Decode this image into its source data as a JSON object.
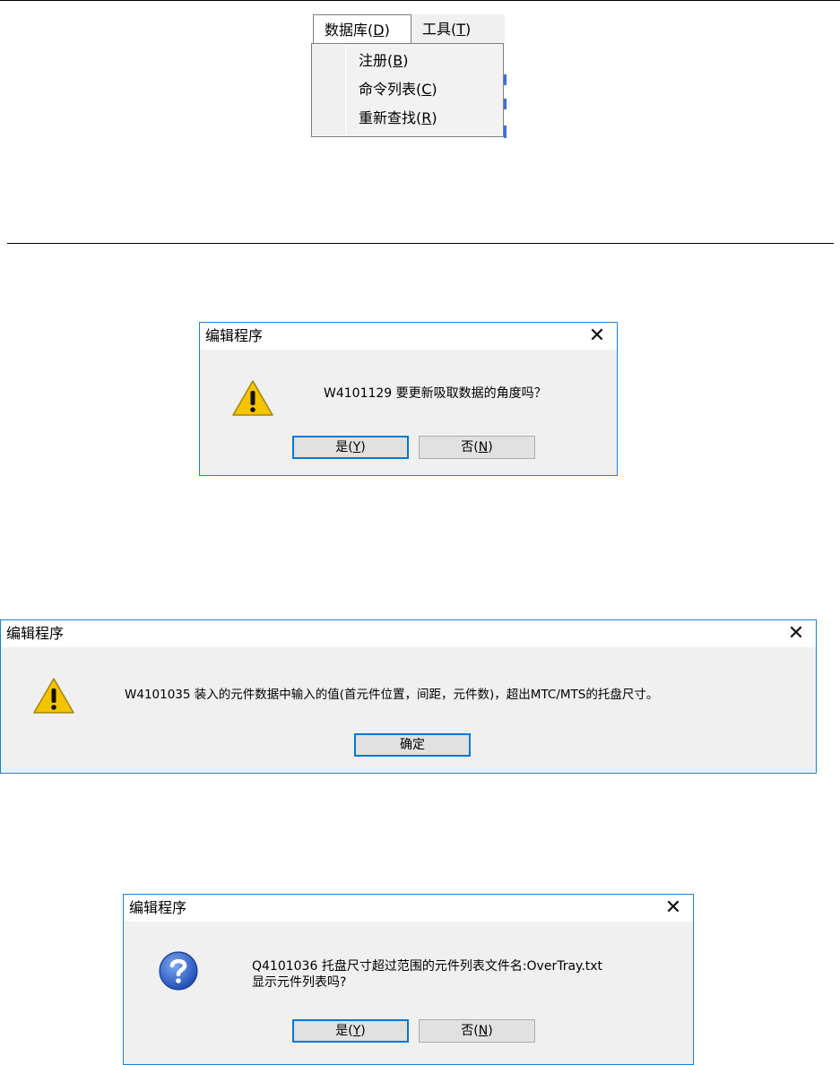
{
  "menu": {
    "tabs": [
      {
        "text": "数据库(",
        "key": "D",
        "close": ")"
      },
      {
        "text": "工具(",
        "key": "T",
        "close": ")"
      }
    ],
    "items": [
      {
        "text": "注册(",
        "key": "B",
        "close": ")"
      },
      {
        "text": "命令列表(",
        "key": "C",
        "close": ")"
      },
      {
        "text": "重新查找(",
        "key": "R",
        "close": ")"
      }
    ]
  },
  "dialog1": {
    "title": "编辑程序",
    "close": "✕",
    "icon": "warning-icon",
    "message": "W4101129 要更新吸取数据的角度吗？",
    "buttons": [
      {
        "text": "是(",
        "key": "Y",
        "close": ")"
      },
      {
        "text": "否(",
        "key": "N",
        "close": ")"
      }
    ]
  },
  "dialog2": {
    "title": "编辑程序",
    "close": "✕",
    "icon": "warning-icon",
    "message": "W4101035 装入的元件数据中输入的值(首元件位置，间距，元件数)，超出MTC/MTS的托盘尺寸。",
    "buttons": [
      {
        "text": "确定"
      }
    ]
  },
  "dialog3": {
    "title": "编辑程序",
    "close": "✕",
    "icon": "question-icon",
    "message_line1": "Q4101036 托盘尺寸超过范围的元件列表文件名:OverTray.txt",
    "message_line2": "显示元件列表吗?",
    "buttons": [
      {
        "text": "是(",
        "key": "Y",
        "close": ")"
      },
      {
        "text": "否(",
        "key": "N",
        "close": ")"
      }
    ]
  },
  "colors": {
    "accent": "#0078d7",
    "dialog_bg": "#f0f0f0",
    "warning": "#f5c400",
    "question": "#2c63c9"
  }
}
